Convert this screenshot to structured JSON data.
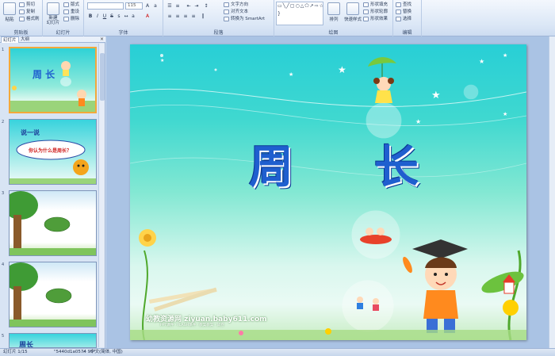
{
  "ribbon": {
    "clipboard": {
      "label": "剪贴板",
      "paste": "粘贴",
      "cut": "剪切",
      "copy": "复制",
      "format_painter": "格式刷"
    },
    "slides": {
      "label": "幻灯片",
      "new_slide": "新建\n幻灯片",
      "layout": "版式",
      "reset": "重设",
      "delete": "删除"
    },
    "font": {
      "label": "字体",
      "font_name": "",
      "font_size": "115"
    },
    "paragraph": {
      "label": "段落",
      "text_direction": "文字方向",
      "align_text": "对齐文本",
      "smartart": "转换为 SmartArt"
    },
    "drawing": {
      "label": "绘图",
      "shapes": "▭╲╱▢○△⬠↗⇨☆{ }",
      "arrange": "排列",
      "quick_styles": "快速样式",
      "shape_fill": "形状填充",
      "shape_outline": "形状轮廓",
      "shape_effects": "形状效果"
    },
    "editing": {
      "label": "编辑",
      "find": "查找",
      "replace": "替换",
      "select": "选择"
    }
  },
  "pane": {
    "tabs": [
      "幻灯片",
      "大纲"
    ],
    "close": "×",
    "slide_numbers": [
      "1",
      "2",
      "3",
      "4",
      "5"
    ],
    "thumbs": [
      {
        "title": "周  长"
      },
      {
        "tag": "说一说",
        "question": "你认为什么是周长？"
      },
      {},
      {},
      {
        "title": "周长"
      }
    ]
  },
  "slide": {
    "title_chars": [
      "周",
      "长"
    ],
    "watermark": "幼教资源网 ziyuan.baby611.com",
    "watermark_sub": "PPT课件 · FLASH课件 · 教案教案 · 试卷"
  },
  "status": {
    "slide_info": "幻灯片 1/15",
    "theme": "\"5440d1a0574 95\"",
    "language": "中文(简体, 中国)"
  },
  "colors": {
    "accent": "#1f5fcf",
    "ribbon": "#dbe7f6",
    "selection": "#f2a93b"
  }
}
